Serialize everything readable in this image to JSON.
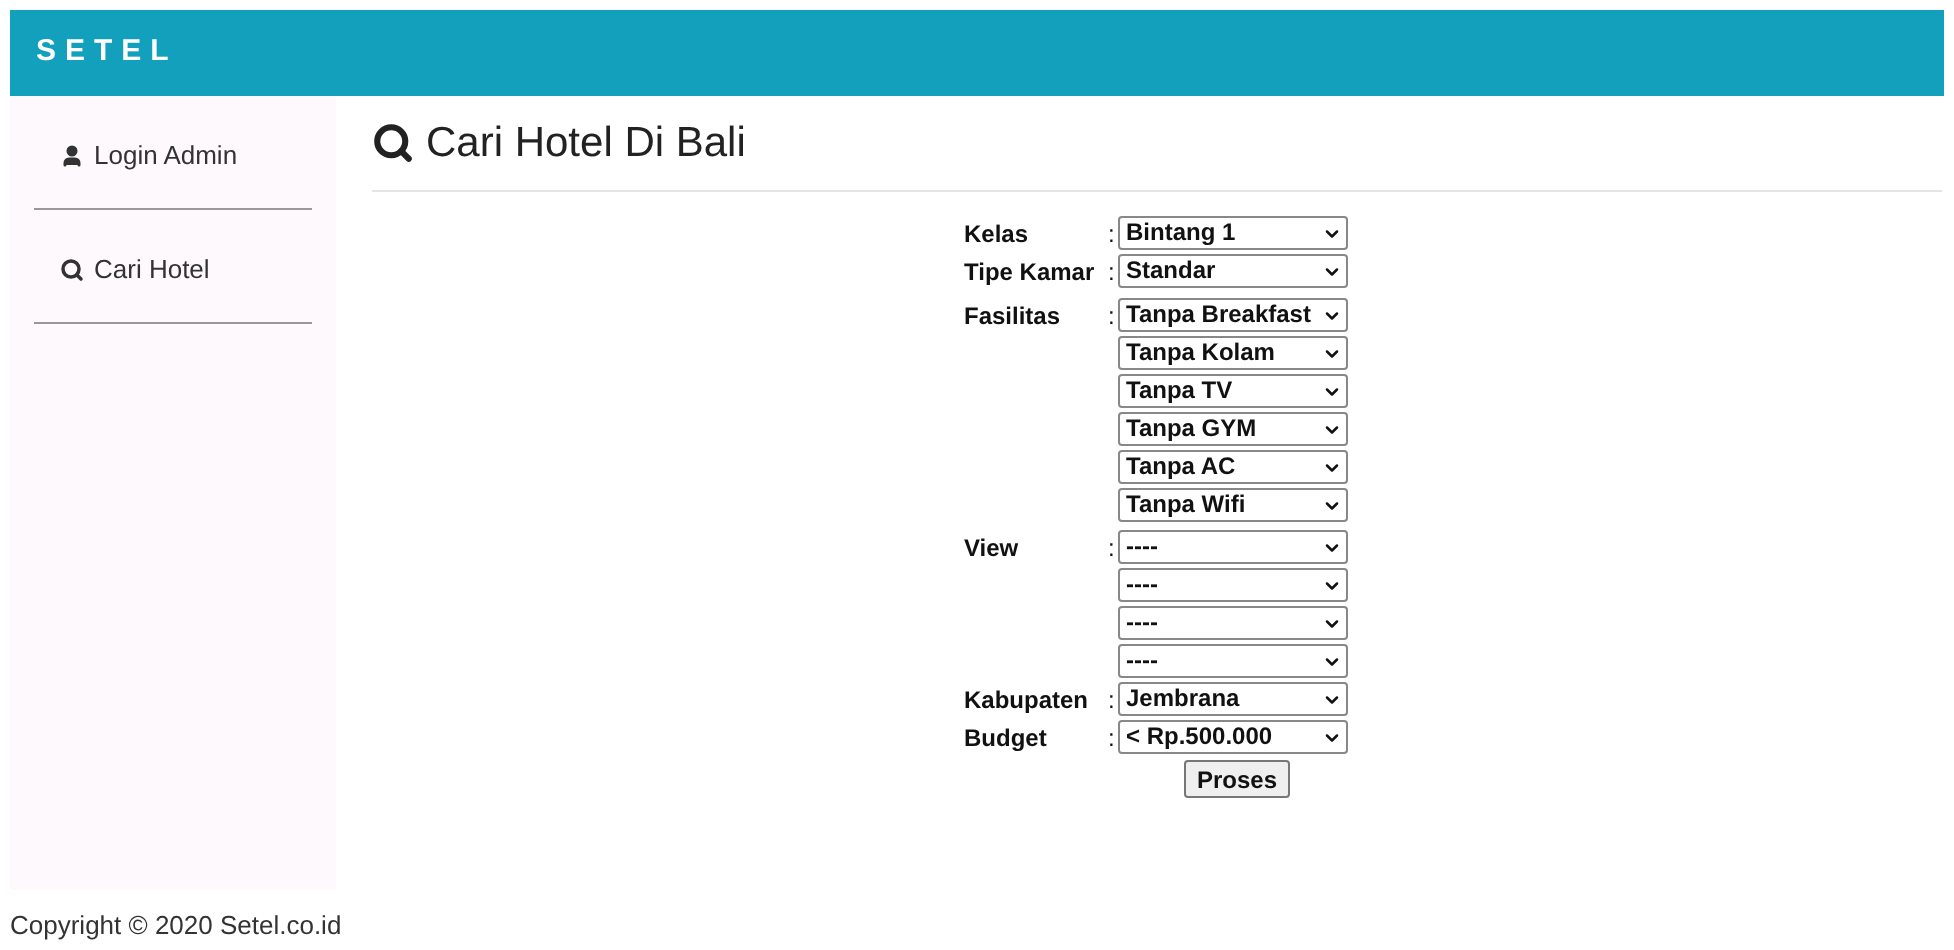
{
  "header": {
    "brand": "SETEL"
  },
  "sidebar": {
    "items": [
      {
        "label": "Login Admin",
        "kind": "user"
      },
      {
        "label": "Cari Hotel",
        "kind": "search"
      }
    ]
  },
  "page": {
    "title": "Cari Hotel Di Bali"
  },
  "form": {
    "rows": [
      {
        "label": "Kelas",
        "values": [
          "Bintang 1"
        ]
      },
      {
        "label": "Tipe Kamar",
        "values": [
          "Standar"
        ]
      },
      {
        "label": "Fasilitas",
        "values": [
          "Tanpa Breakfast",
          "Tanpa Kolam",
          "Tanpa TV",
          "Tanpa GYM",
          "Tanpa AC",
          "Tanpa Wifi"
        ]
      },
      {
        "label": "View",
        "values": [
          "----",
          "----",
          "----",
          "----"
        ]
      },
      {
        "label": "Kabupaten",
        "values": [
          "Jembrana"
        ]
      },
      {
        "label": "Budget",
        "values": [
          "< Rp.500.000"
        ]
      }
    ],
    "separator": ":",
    "submit": "Proses"
  },
  "footer": {
    "copyright": "Copyright © 2020 Setel.co.id"
  }
}
